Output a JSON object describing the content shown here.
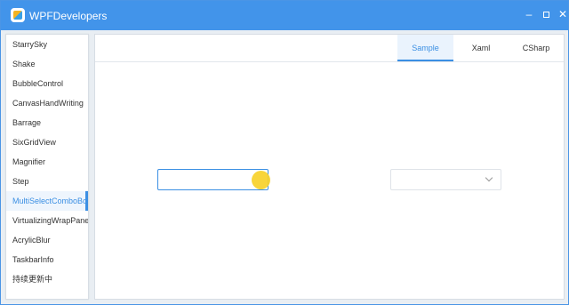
{
  "window": {
    "title": "WPFDevelopers",
    "controls": {
      "minimize": "–",
      "close": "✕"
    }
  },
  "sidebar": {
    "items": [
      {
        "label": "StarrySky"
      },
      {
        "label": "Shake"
      },
      {
        "label": "BubbleControl"
      },
      {
        "label": "CanvasHandWriting"
      },
      {
        "label": "Barrage"
      },
      {
        "label": "SixGridView"
      },
      {
        "label": "Magnifier"
      },
      {
        "label": "Step"
      },
      {
        "label": "MultiSelectComboBox",
        "active": true
      },
      {
        "label": "VirtualizingWrapPanel"
      },
      {
        "label": "AcrylicBlur"
      },
      {
        "label": "TaskbarInfo"
      },
      {
        "label": "持续更新中"
      }
    ]
  },
  "tabs": [
    {
      "label": "Sample",
      "active": true
    },
    {
      "label": "Xaml"
    },
    {
      "label": "CSharp"
    }
  ],
  "combos": {
    "left_value": "",
    "right_value": ""
  },
  "colors": {
    "accent": "#3b8fe3",
    "titlebar": "#4294ea",
    "cursor_highlight": "#f7d12a"
  }
}
